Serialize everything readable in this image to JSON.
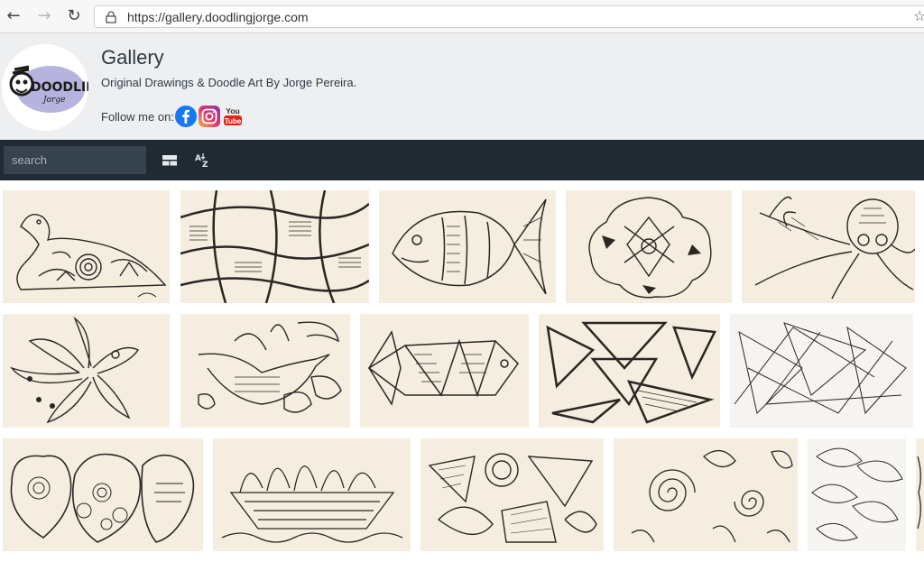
{
  "browser": {
    "url": "https://gallery.doodlingjorge.com",
    "back_icon": "back-arrow-icon",
    "forward_icon": "forward-arrow-icon",
    "reload_icon": "reload-icon",
    "bookmark_icon": "star-icon"
  },
  "header": {
    "logo_text_top": "DOODLING",
    "logo_text_bottom": "Jorge",
    "title": "Gallery",
    "subtitle": "Original Drawings & Doodle Art By Jorge Pereira.",
    "follow_label": "Follow me on:",
    "socials": [
      {
        "name": "facebook",
        "color": "#1877f2"
      },
      {
        "name": "instagram",
        "color": "#c13584"
      },
      {
        "name": "youtube",
        "color": "#e62117",
        "label_top": "You",
        "label_bottom": "Tube"
      }
    ]
  },
  "toolbar": {
    "search_placeholder": "search",
    "layout_icon": "grid-layout-icon",
    "sort_icon": "sort-az-icon"
  },
  "gallery": {
    "items": [
      {
        "subject": "duck"
      },
      {
        "subject": "stone-pattern"
      },
      {
        "subject": "fish"
      },
      {
        "subject": "flower"
      },
      {
        "subject": "octopus"
      },
      {
        "subject": "bird-flower"
      },
      {
        "subject": "bird"
      },
      {
        "subject": "geometric-fish"
      },
      {
        "subject": "triangles"
      },
      {
        "subject": "line-triangles"
      },
      {
        "subject": "hearts"
      },
      {
        "subject": "boat"
      },
      {
        "subject": "shapes"
      },
      {
        "subject": "spirals"
      },
      {
        "subject": "leaves"
      },
      {
        "subject": "partial"
      }
    ]
  },
  "colors": {
    "header_bg": "#eeeff1",
    "toolbar_bg": "#1f2a33",
    "search_bg": "#36434e",
    "title_text": "#2d3a44",
    "paper": "#f4ede0",
    "ink": "#2a2622"
  }
}
